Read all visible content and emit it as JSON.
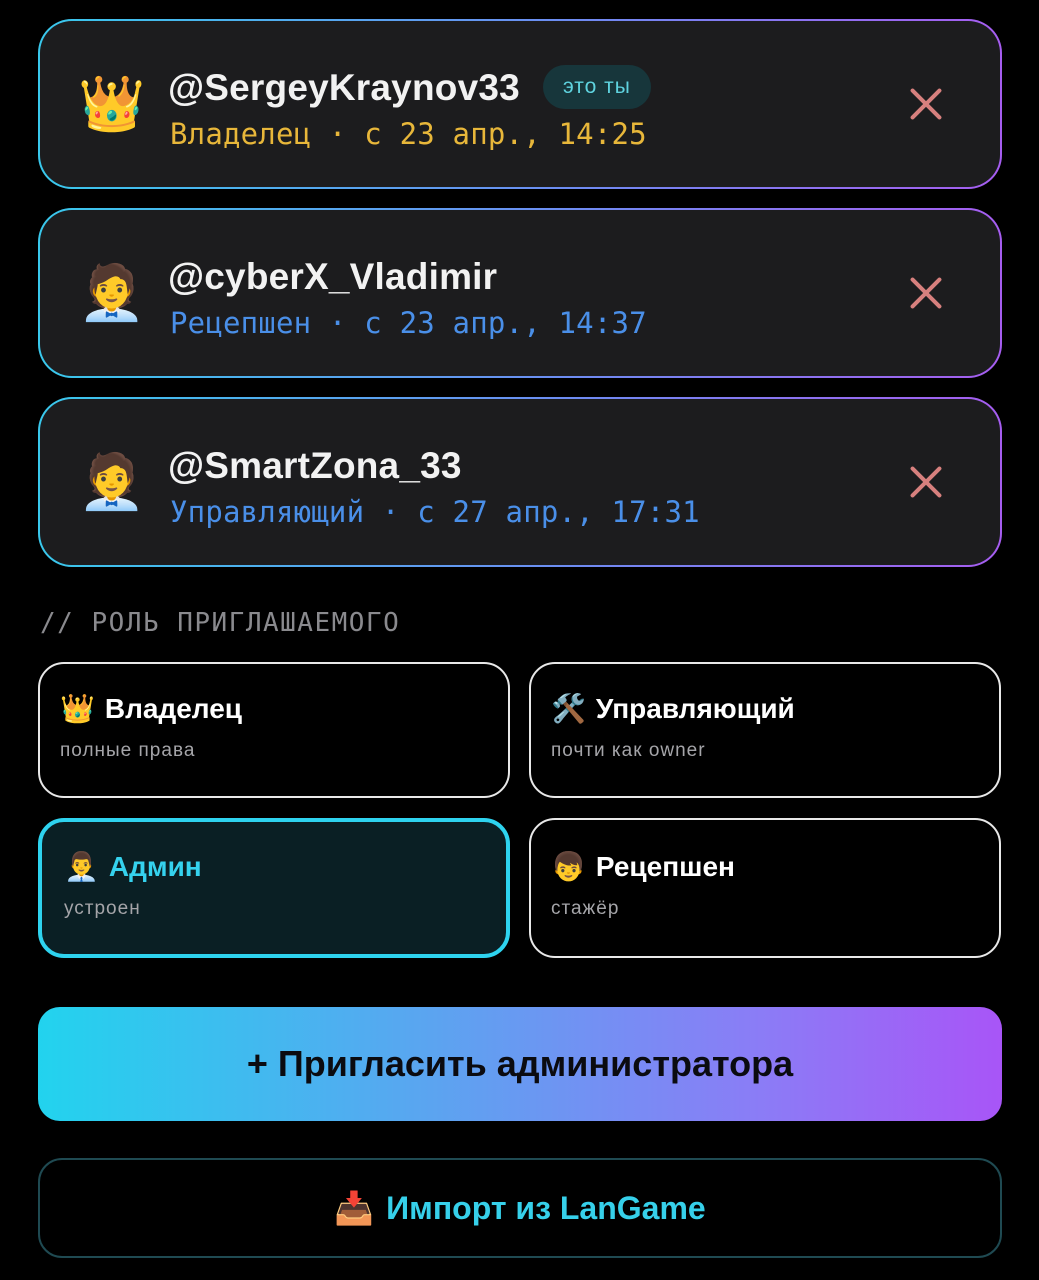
{
  "members": [
    {
      "avatar_icon": "crown-icon",
      "avatar_glyph": "👑",
      "username": "@SergeyKraynov33",
      "badge": "это ты",
      "meta": "Владелец · с 23 апр., 14:25",
      "meta_color": "#e8b73a"
    },
    {
      "avatar_icon": "person-icon",
      "avatar_glyph": "🧑‍💼",
      "username": "@cyberX_Vladimir",
      "badge": "",
      "meta": "Рецепшен · с 23 апр., 14:37",
      "meta_color": "#4a8fe8"
    },
    {
      "avatar_icon": "person-icon",
      "avatar_glyph": "🧑‍💼",
      "username": "@SmartZona_33",
      "badge": "",
      "meta": "Управляющий · с 27 апр., 17:31",
      "meta_color": "#4a8fe8"
    }
  ],
  "section_label": "// РОЛЬ ПРИГЛАШАЕМОГО",
  "roles": [
    {
      "icon": "crown-icon",
      "glyph": "👑",
      "title": "Владелец",
      "subtitle": "полные права",
      "selected": false
    },
    {
      "icon": "tools-icon",
      "glyph": "🛠️",
      "title": "Управляющий",
      "subtitle": "почти как owner",
      "selected": false
    },
    {
      "icon": "office-worker-icon",
      "glyph": "👨‍💼",
      "title": "Админ",
      "subtitle": "устроен",
      "selected": true
    },
    {
      "icon": "person-icon",
      "glyph": "👦",
      "title": "Рецепшен",
      "subtitle": "стажёр",
      "selected": false
    }
  ],
  "invite_button": "+ Пригласить администратора",
  "import_button": {
    "icon": "inbox-tray-icon",
    "glyph": "📥",
    "label": "Импорт из LanGame"
  },
  "colors": {
    "accent_cyan": "#2ed3ef",
    "accent_purple": "#a855f7",
    "owner_gold": "#e8b73a",
    "role_blue": "#4a8fe8",
    "remove_red": "#d7807e"
  }
}
